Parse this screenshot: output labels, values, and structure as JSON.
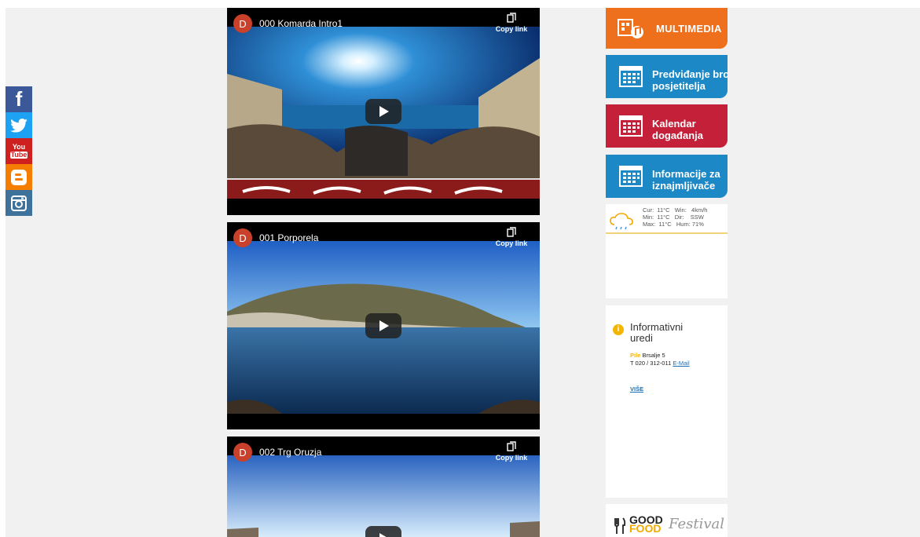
{
  "social": {
    "facebook": "f",
    "youtube_top": "You",
    "youtube_bottom": "Tube",
    "icons": [
      "facebook-icon",
      "twitter-icon",
      "youtube-icon",
      "blogger-icon",
      "instagram-icon"
    ]
  },
  "videos": [
    {
      "avatar": "D",
      "title": "000 Komarda Intro1",
      "copy": "Copy link"
    },
    {
      "avatar": "D",
      "title": "001 Porporela",
      "copy": "Copy link"
    },
    {
      "avatar": "D",
      "title": "002 Trg Oruzja",
      "copy": "Copy link"
    }
  ],
  "sidebar": {
    "multimedia": "MULTIMEDIA",
    "forecast_line1": "Predviđanje broja",
    "forecast_line2": "posjetitelja",
    "calendar_line1": "Kalendar",
    "calendar_line2": "događanja",
    "rental_line1": "Informacije za",
    "rental_line2": "iznajmljivače",
    "colors": {
      "orange": "#ee6f1c",
      "blue": "#1c89c6",
      "red": "#c4203a"
    }
  },
  "weather": {
    "line1": "Cur:  11°C   Win:   4km/h",
    "line2": "Min:  11°C   Dir:    SSW",
    "line3": "Max:  11°C   Hum: 71%"
  },
  "info": {
    "badge": "i",
    "title_line1": "Informativni",
    "title_line2": "uredi",
    "place": "Pile",
    "address": "Brsalje 5",
    "phone": "T 020 / 312-011",
    "email": "E-Mail",
    "more": "VIŠE"
  },
  "logo": {
    "good": "GOOD",
    "food": "FOOD",
    "festival": "Festival"
  }
}
